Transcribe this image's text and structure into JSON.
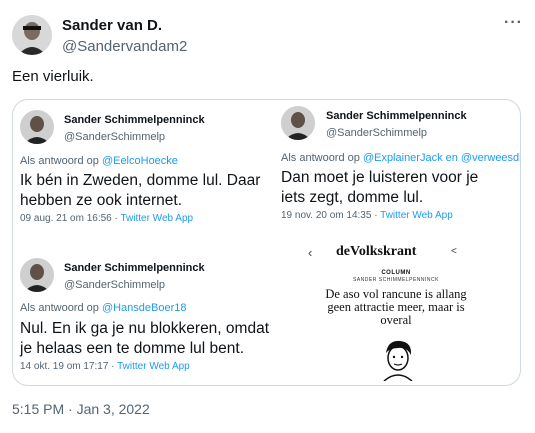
{
  "tweet": {
    "author_name": "Sander van D.",
    "author_handle": "@Sandervandam2",
    "more_label": "···",
    "text": "Een vierluik.",
    "timestamp": "5:15 PM · Jan 3, 2022"
  },
  "quoted": [
    {
      "name": "Sander Schimmelpenninck",
      "handle": "@SanderSchimmelp",
      "reply_prefix": "Als antwoord op ",
      "reply_to": "@EelcoHoecke",
      "body": "Ik bén in Zweden, domme lul. Daar hebben ze ook internet.",
      "date": "09 aug. 21 om 16:56 · ",
      "app": "Twitter Web App"
    },
    {
      "name": "Sander Schimmelpenninck",
      "handle": "@SanderSchimmelp",
      "reply_prefix": "Als antwoord op ",
      "reply_to": "@ExplainerJack en @verweesdlinks",
      "body": "Dan moet je luisteren voor je iets zegt, domme lul.",
      "date": "19 nov. 20 om 14:35 · ",
      "app": "Twitter Web App"
    },
    {
      "name": "Sander Schimmelpenninck",
      "handle": "@SanderSchimmelp",
      "reply_prefix": "Als antwoord op ",
      "reply_to": "@HansdeBoer18",
      "body": "Nul. En ik ga je nu blokkeren, omdat je helaas een te domme lul bent.",
      "date": "14 okt. 19 om 17:17 · ",
      "app": "Twitter Web App"
    }
  ],
  "volkskrant": {
    "logo": "deVolkskrant",
    "back": "‹",
    "share": "<",
    "column_label": "COLUMN",
    "author": "SANDER SCHIMMELPENNINCK",
    "headline": "De aso vol rancune is allang geen attractie meer, maar is overal"
  }
}
